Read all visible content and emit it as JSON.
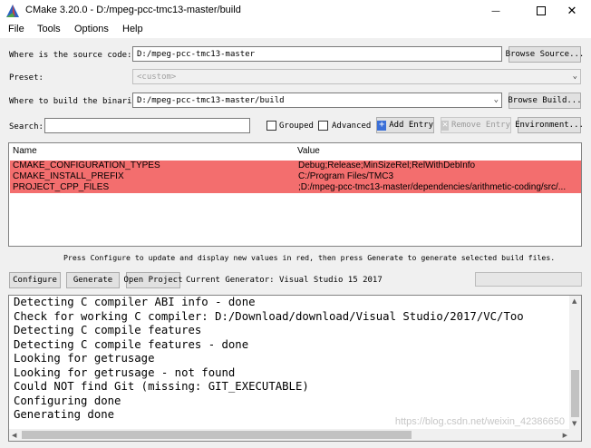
{
  "window": {
    "title": "CMake 3.20.0 - D:/mpeg-pcc-tmc13-master/build",
    "icon": "cmake-logo-icon"
  },
  "menu": [
    "File",
    "Tools",
    "Options",
    "Help"
  ],
  "source": {
    "label": "Where is the source code:",
    "value": "D:/mpeg-pcc-tmc13-master",
    "browse": "Browse Source..."
  },
  "preset": {
    "label": "Preset:",
    "value": "<custom>"
  },
  "build": {
    "label": "Where to build the binaries:",
    "value": "D:/mpeg-pcc-tmc13-master/build",
    "browse": "Browse Build..."
  },
  "search": {
    "label": "Search:",
    "value": "",
    "grouped": "Grouped",
    "advanced": "Advanced",
    "add_entry": "Add Entry",
    "remove_entry": "Remove Entry",
    "environment": "Environment..."
  },
  "table": {
    "columns": [
      "Name",
      "Value"
    ],
    "highlight_color": "#f36e6e",
    "rows": [
      {
        "name": "CMAKE_CONFIGURATION_TYPES",
        "value": "Debug;Release;MinSizeRel;RelWithDebInfo"
      },
      {
        "name": "CMAKE_INSTALL_PREFIX",
        "value": "C:/Program Files/TMC3"
      },
      {
        "name": "PROJECT_CPP_FILES",
        "value": ";D:/mpeg-pcc-tmc13-master/dependencies/arithmetic-coding/src/..."
      }
    ]
  },
  "hint": "Press Configure to update and display new values in red, then press Generate to generate selected build files.",
  "actions": {
    "configure": "Configure",
    "generate": "Generate",
    "open_project": "Open Project",
    "generator": "Current Generator: Visual Studio 15 2017"
  },
  "log": [
    "Detecting C compiler ABI info - done",
    "Check for working C compiler: D:/Download/download/Visual Studio/2017/VC/Too",
    "Detecting C compile features",
    "Detecting C compile features - done",
    "Looking for getrusage",
    "Looking for getrusage - not found",
    "Could NOT find Git (missing: GIT_EXECUTABLE)",
    "Configuring done",
    "Generating done"
  ],
  "watermark": "https://blog.csdn.net/weixin_42386650"
}
